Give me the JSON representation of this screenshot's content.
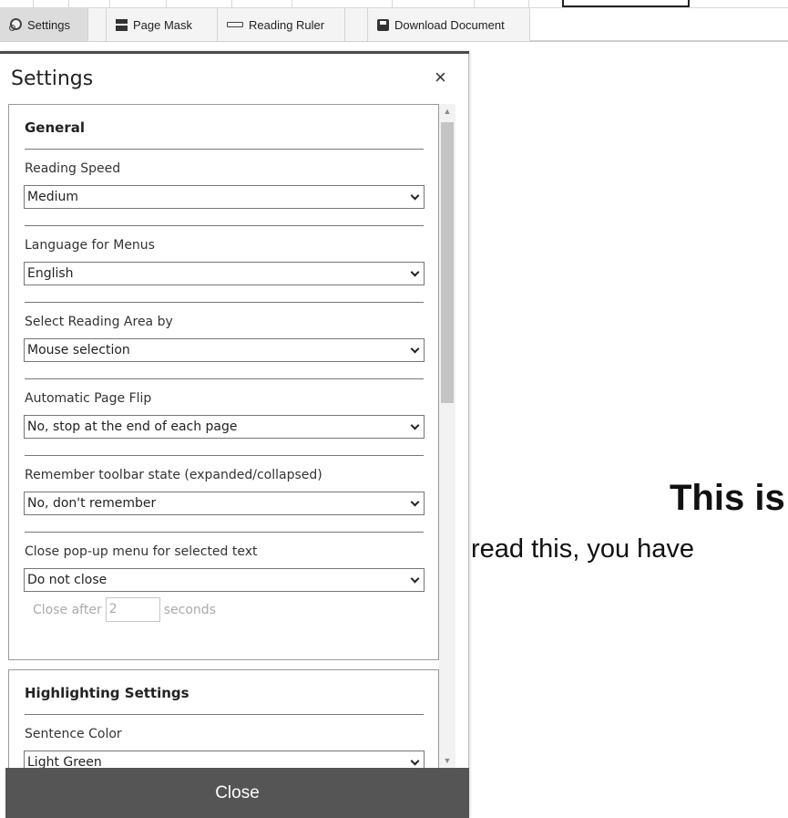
{
  "toolbar": {
    "settings_label": "Settings",
    "page_mask_label": "Page Mask",
    "reading_ruler_label": "Reading Ruler",
    "download_label": "Download Document"
  },
  "document": {
    "heading": "This is",
    "line": "read this, you have"
  },
  "settings": {
    "title": "Settings",
    "close_icon": "×",
    "general": {
      "title": "General",
      "reading_speed": {
        "label": "Reading Speed",
        "value": "Medium"
      },
      "language": {
        "label": "Language for Menus",
        "value": "English"
      },
      "reading_area": {
        "label": "Select Reading Area by",
        "value": "Mouse selection"
      },
      "page_flip": {
        "label": "Automatic Page Flip",
        "value": "No, stop at the end of each page"
      },
      "toolbar_state": {
        "label": "Remember toolbar state (expanded/collapsed)",
        "value": "No, don't remember"
      },
      "popup_close": {
        "label": "Close pop-up menu for selected text",
        "value": "Do not close"
      },
      "close_after": {
        "prefix": "Close after",
        "value": "2",
        "suffix": "seconds"
      }
    },
    "highlighting": {
      "title": "Highlighting Settings",
      "sentence_color": {
        "label": "Sentence Color",
        "value": "Light Green"
      }
    },
    "close_button": "Close"
  },
  "icons": {
    "settings": "gear-icon",
    "page_mask": "page-mask-icon",
    "reading_ruler": "ruler-icon",
    "download": "floppy-disk-icon",
    "select_arrow": "chevron-down-icon"
  },
  "colors": {
    "toolbar_bg": "#f4f4f4",
    "active_tab": "#dcdcdc",
    "close_bar": "#555555",
    "group_border": "#9a9a9a"
  }
}
